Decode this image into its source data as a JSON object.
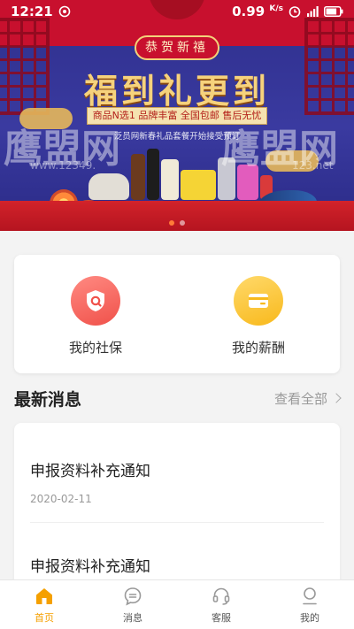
{
  "status_bar": {
    "time": "12:21",
    "speed": "0.99",
    "speed_unit": "K/s",
    "battery": "80"
  },
  "banner": {
    "greeting": "恭贺新禧",
    "title": "福到礼更到",
    "ribbon": "商品N选1  品牌丰富  全国包邮  售后无忧",
    "subtitle": "泛员网新春礼品套餐开始接受预订",
    "watermark_left": "鹰盟网",
    "watermark_right": "鹰盟网",
    "watermark_url_left": "www.12349.",
    "watermark_url_right": "123.net",
    "slide_count": 2,
    "active_slide": 1,
    "accent_color": "#ff7b38"
  },
  "quick_actions": [
    {
      "label": "我的社保",
      "icon": "shield-icon",
      "color": "#f0514a"
    },
    {
      "label": "我的薪酬",
      "icon": "wallet-icon",
      "color": "#f8b91c"
    }
  ],
  "news": {
    "title": "最新消息",
    "view_all": "查看全部",
    "items": [
      {
        "title": "申报资料补充通知",
        "date": "2020-02-11"
      },
      {
        "title": "申报资料补充通知",
        "date": ""
      }
    ]
  },
  "tabbar": {
    "active_color": "#f5a000",
    "items": [
      {
        "label": "首页",
        "icon": "home-icon",
        "active": true
      },
      {
        "label": "消息",
        "icon": "message-icon",
        "active": false
      },
      {
        "label": "客服",
        "icon": "headset-icon",
        "active": false
      },
      {
        "label": "我的",
        "icon": "user-icon",
        "active": false
      }
    ]
  }
}
